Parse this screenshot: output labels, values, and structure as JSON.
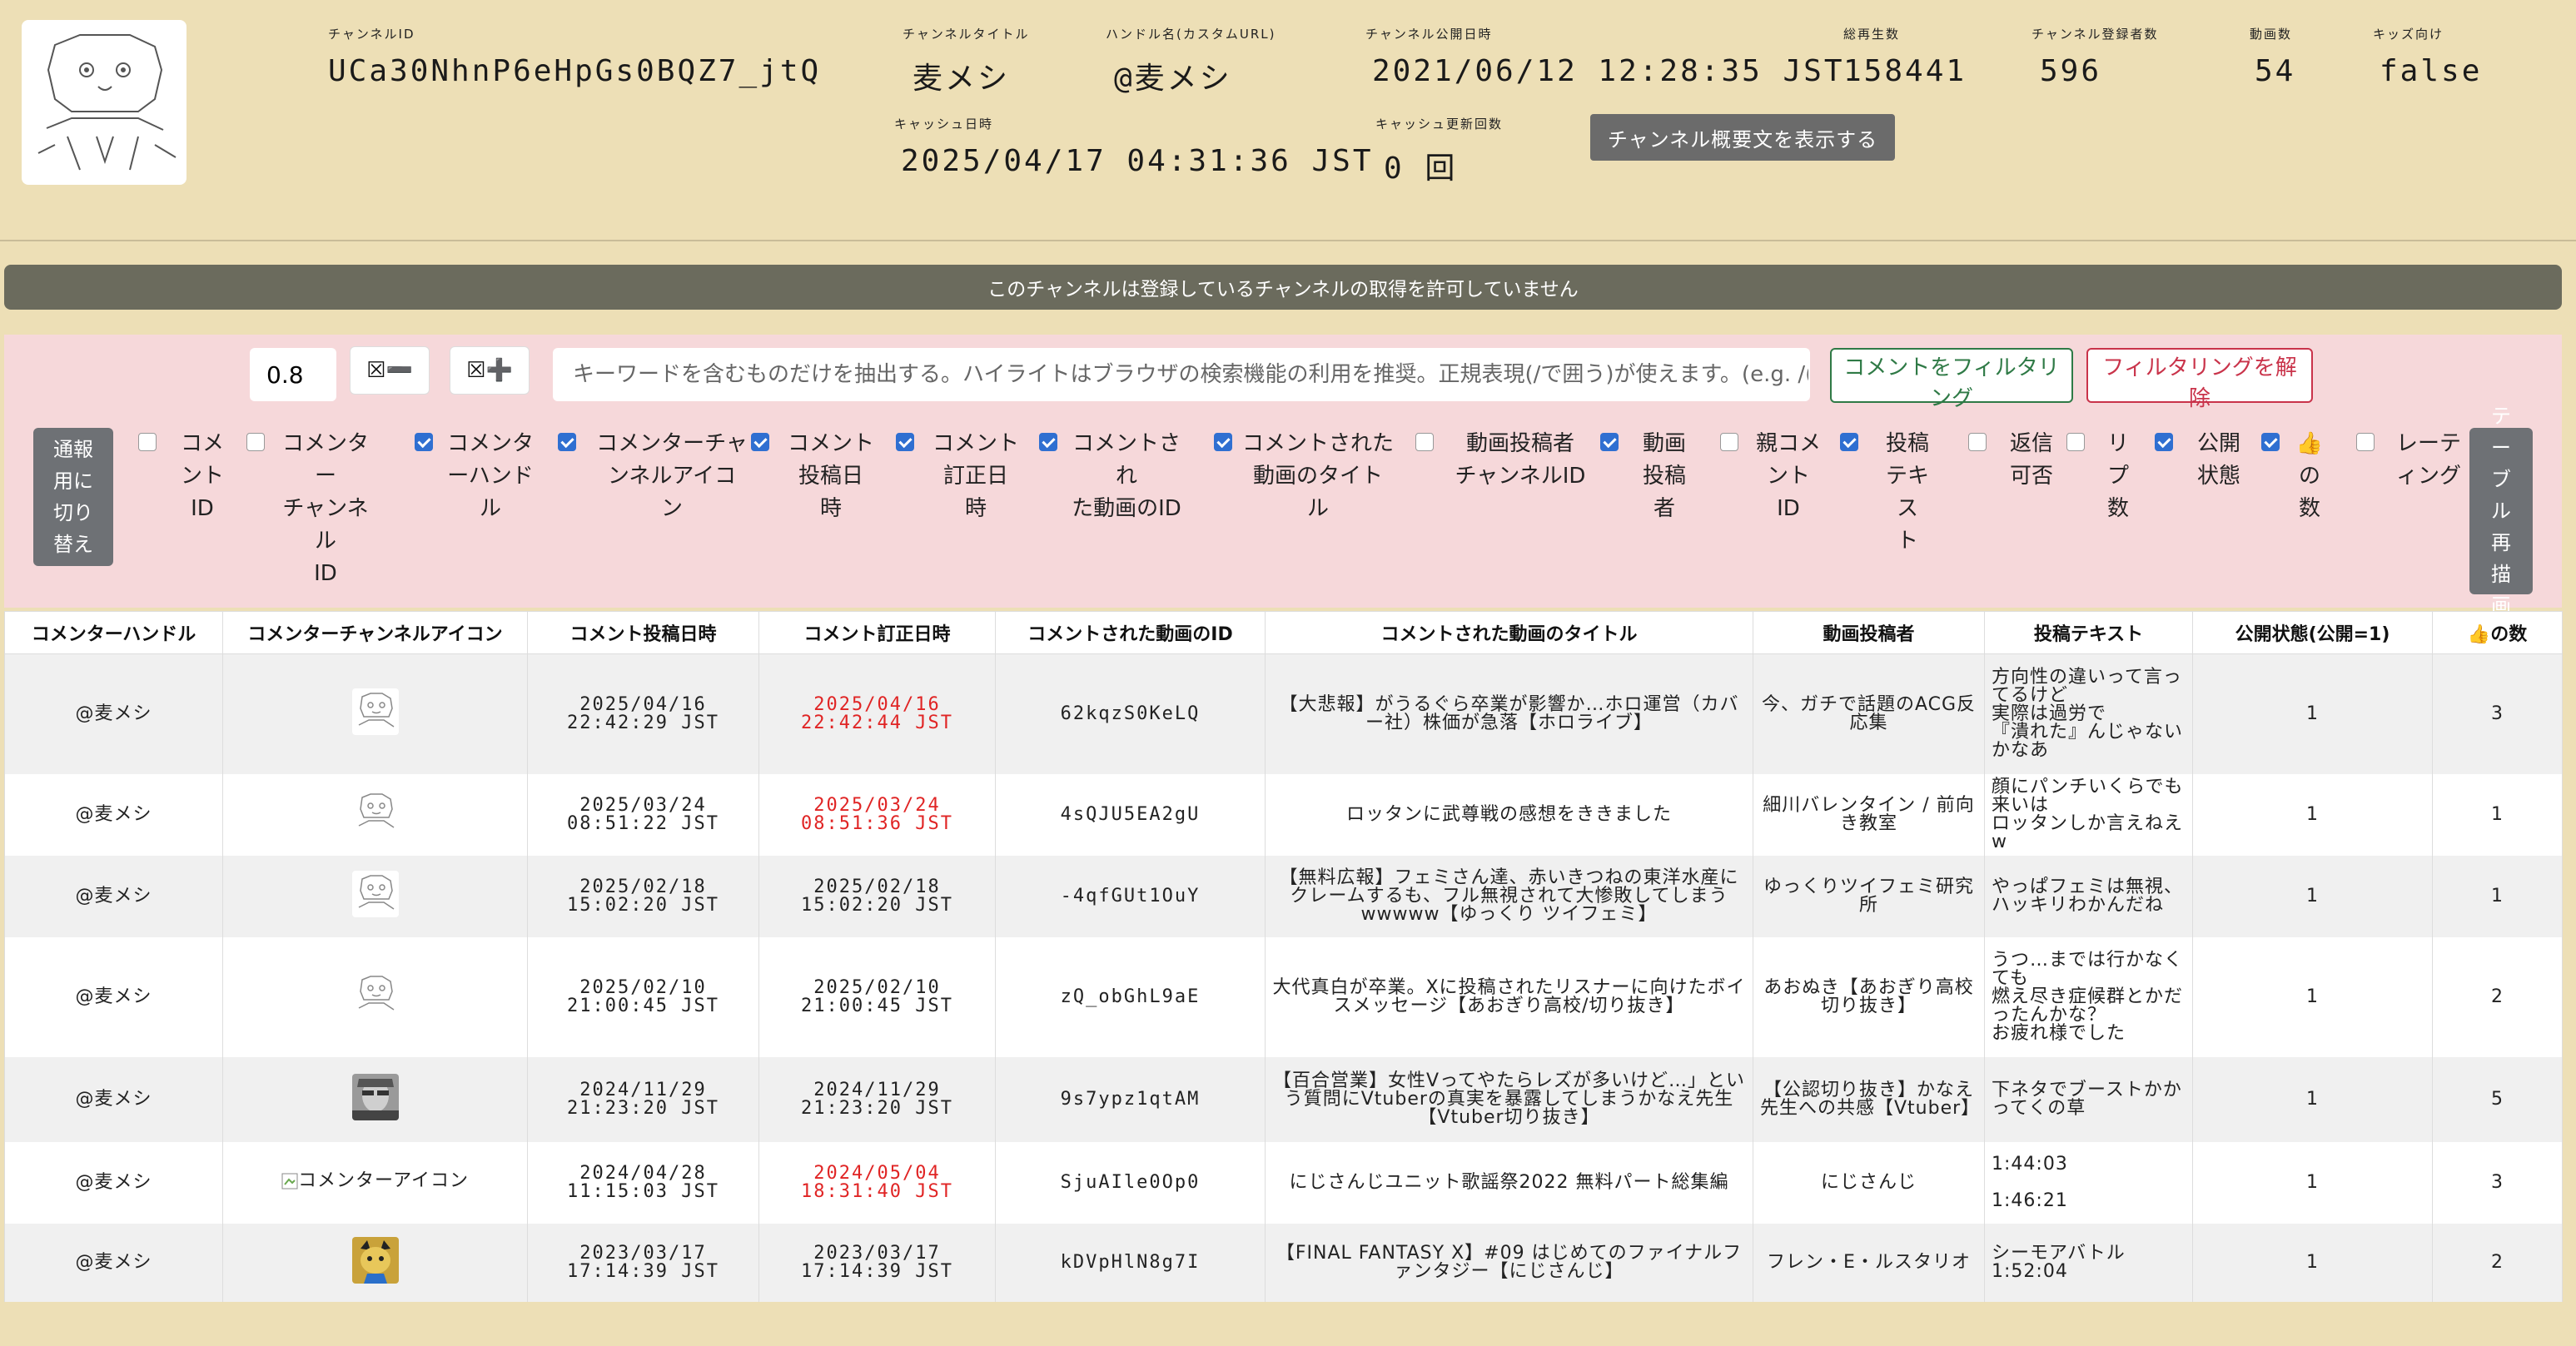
{
  "header": {
    "channel_id_label": "チャンネルID",
    "channel_id": "UCa30NhnP6eHpGs0BQZ7_jtQ",
    "title_label": "チャンネルタイトル",
    "title": "麦メシ",
    "handle_label": "ハンドル名(カスタムURL)",
    "handle": "@麦メシ",
    "published_label": "チャンネル公開日時",
    "published": "2021/06/12 12:28:35 JST",
    "views_label": "総再生数",
    "views": "158441",
    "subs_label": "チャンネル登録者数",
    "subs": "596",
    "videos_label": "動画数",
    "videos": "54",
    "kids_label": "キッズ向け",
    "kids": "false",
    "cache_label": "キャッシュ日時",
    "cache": "2025/04/17 04:31:36 JST",
    "cache_count_label": "キャッシュ更新回数",
    "cache_count": "0 回",
    "desc_button": "チャンネル概要文を表示する"
  },
  "banner": "このチャンネルは登録しているチャンネルの取得を許可していません",
  "filter": {
    "factor": "0.8",
    "minus_label": "☒➖",
    "plus_label": "☒➕",
    "keyword_placeholder": "キーワードを含むものだけを抽出する。ハイライトはブラウザの検索機能の利用を推奨。正規表現(/で囲う)が使えます。(e.g. /(BC|AD",
    "filter_button": "コメントをフィルタリング",
    "clear_button": "フィルタリングを解除",
    "report_button": "通報用に切り替え",
    "redraw_button": "テーブル再描画"
  },
  "columns": [
    {
      "label": "コメントID",
      "checked": false
    },
    {
      "label": "コメンターチャンネルID",
      "checked": false
    },
    {
      "label": "コメンターハンドル",
      "checked": true
    },
    {
      "label": "コメンターチャンネルアイコン",
      "checked": true
    },
    {
      "label": "コメント投稿日時",
      "checked": true
    },
    {
      "label": "コメント訂正日時",
      "checked": true
    },
    {
      "label": "コメントされた動画のID",
      "checked": true
    },
    {
      "label": "コメントされた動画のタイトル",
      "checked": true
    },
    {
      "label": "動画投稿者チャンネルID",
      "checked": false
    },
    {
      "label": "動画投稿者",
      "checked": true
    },
    {
      "label": "親コメントID",
      "checked": false
    },
    {
      "label": "投稿テキスト",
      "checked": true
    },
    {
      "label": "返信可否",
      "checked": false
    },
    {
      "label": "リプ数",
      "checked": false
    },
    {
      "label": "公開状態",
      "checked": true
    },
    {
      "label": "の数",
      "checked": true
    },
    {
      "label": "レーティング",
      "checked": false
    }
  ],
  "table": {
    "headers": [
      "コメンターハンドル",
      "コメンターチャンネルアイコン",
      "コメント投稿日時",
      "コメント訂正日時",
      "コメントされた動画のID",
      "コメントされた動画のタイトル",
      "動画投稿者",
      "投稿テキスト",
      "公開状態(公開=1)",
      "の数"
    ],
    "broken_icon_alt": "コメンターアイコン",
    "rows": [
      {
        "handle": "@麦メシ",
        "icon": "ascii-face",
        "posted": "2025/04/16\n22:42:29 JST",
        "edited": "2025/04/16\n22:42:44 JST",
        "edited_red": true,
        "video_id": "62kqzS0KeLQ",
        "video_title": "【大悲報】がうるぐら卒業が影響か…ホロ運営（カバー社）株価が急落【ホロライブ】",
        "uploader": "今、ガチで話題のACG反応集",
        "text": "方向性の違いって言ってるけど\n実際は過労で\n『潰れた』んじゃないかなあ",
        "public": "1",
        "likes": "3"
      },
      {
        "handle": "@麦メシ",
        "icon": "ascii-face",
        "posted": "2025/03/24\n08:51:22 JST",
        "edited": "2025/03/24\n08:51:36 JST",
        "edited_red": true,
        "video_id": "4sQJU5EA2gU",
        "video_title": "ロッタンに武尊戦の感想をききました",
        "uploader": "細川バレンタイン / 前向き教室",
        "text": "顔にパンチいくらでも来いは\nロッタンしか言えねえw",
        "public": "1",
        "likes": "1"
      },
      {
        "handle": "@麦メシ",
        "icon": "ascii-face",
        "posted": "2025/02/18\n15:02:20 JST",
        "edited": "2025/02/18\n15:02:20 JST",
        "edited_red": false,
        "video_id": "-4qfGUt1OuY",
        "video_title": "【無料広報】フェミさん達、赤いきつねの東洋水産にクレームするも、フル無視されて大惨敗してしまうwwwww【ゆっくり ツイフェミ】",
        "uploader": "ゆっくりツイフェミ研究所",
        "text": "やっぱフェミは無視、\nハッキリわかんだね",
        "public": "1",
        "likes": "1"
      },
      {
        "handle": "@麦メシ",
        "icon": "ascii-face",
        "posted": "2025/02/10\n21:00:45 JST",
        "edited": "2025/02/10\n21:00:45 JST",
        "edited_red": false,
        "video_id": "zQ_obGhL9aE",
        "video_title": "大代真白が卒業。Xに投稿されたリスナーに向けたボイスメッセージ【あおぎり高校/切り抜き】",
        "uploader": "あおぬき【あおぎり高校切り抜き】",
        "text": "うつ…までは行かなくても\n燃え尽き症候群とかだったんかな？\nお疲れ様でした",
        "public": "1",
        "likes": "2"
      },
      {
        "handle": "@麦メシ",
        "icon": "photo-face",
        "posted": "2024/11/29\n21:23:20 JST",
        "edited": "2024/11/29\n21:23:20 JST",
        "edited_red": false,
        "video_id": "9s7ypz1qtAM",
        "video_title": "【百合営業】女性Vってやたらレズが多いけど…」という質問にVtuberの真実を暴露してしまうかなえ先生【Vtuber切り抜き】",
        "uploader": "【公認切り抜き】かなえ先生への共感【Vtuber】",
        "text": "下ネタでブーストかかってくの草",
        "public": "1",
        "likes": "5"
      },
      {
        "handle": "@麦メシ",
        "icon": "broken",
        "posted": "2024/04/28\n11:15:03 JST",
        "edited": "2024/05/04\n18:31:40 JST",
        "edited_red": true,
        "video_id": "SjuAIle0Op0",
        "video_title": "にじさんじユニット歌謡祭2022 無料パート総集編",
        "uploader": "にじさんじ",
        "text": "1:44:03\n\n1:46:21",
        "public": "1",
        "likes": "3"
      },
      {
        "handle": "@麦メシ",
        "icon": "cat",
        "posted": "2023/03/17\n17:14:39 JST",
        "edited": "2023/03/17\n17:14:39 JST",
        "edited_red": false,
        "video_id": "kDVpHlN8g7I",
        "video_title": "【FINAL FANTASY X】#09 はじめてのファイナルファンタジー【にじさんじ】",
        "uploader": "フレン・E・ルスタリオ",
        "text": "シーモアバトル\n1:52:04",
        "public": "1",
        "likes": "2"
      }
    ]
  }
}
